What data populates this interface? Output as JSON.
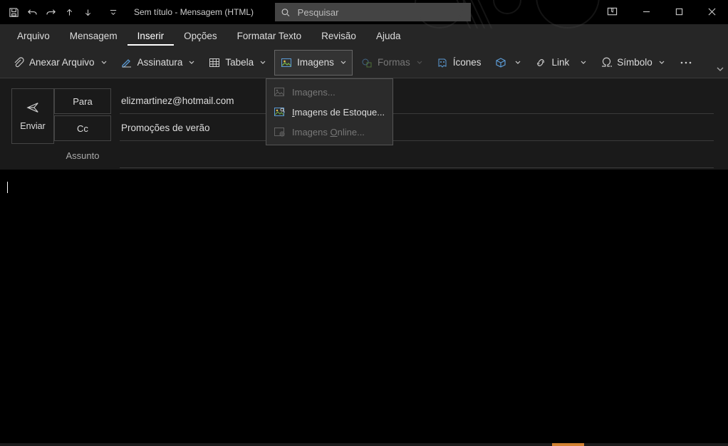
{
  "window": {
    "title": "Sem título  -  Mensagem (HTML)"
  },
  "search": {
    "placeholder": "Pesquisar"
  },
  "tabs": {
    "arquivo": "Arquivo",
    "mensagem": "Mensagem",
    "inserir": "Inserir",
    "opcoes": "Opções",
    "formatar": "Formatar Texto",
    "revisao": "Revisão",
    "ajuda": "Ajuda"
  },
  "ribbon": {
    "anexar": "Anexar Arquivo",
    "assinatura": "Assinatura",
    "tabela": "Tabela",
    "imagens": "Imagens",
    "formas": "Formas",
    "icones": "Ícones",
    "link": "Link",
    "simbolo": "Símbolo"
  },
  "dropdown": {
    "imagens": "Imagens...",
    "estoque": "Imagens de Estoque...",
    "online_pre": "Imagens ",
    "online_u": "O",
    "online_post": "nline..."
  },
  "compose": {
    "enviar": "Enviar",
    "para": "Para",
    "cc": "Cc",
    "assunto": "Assunto",
    "to_value": "elizmartinez@hotmail.com",
    "cc_value": "Promoções de verão",
    "subject_value": ""
  }
}
